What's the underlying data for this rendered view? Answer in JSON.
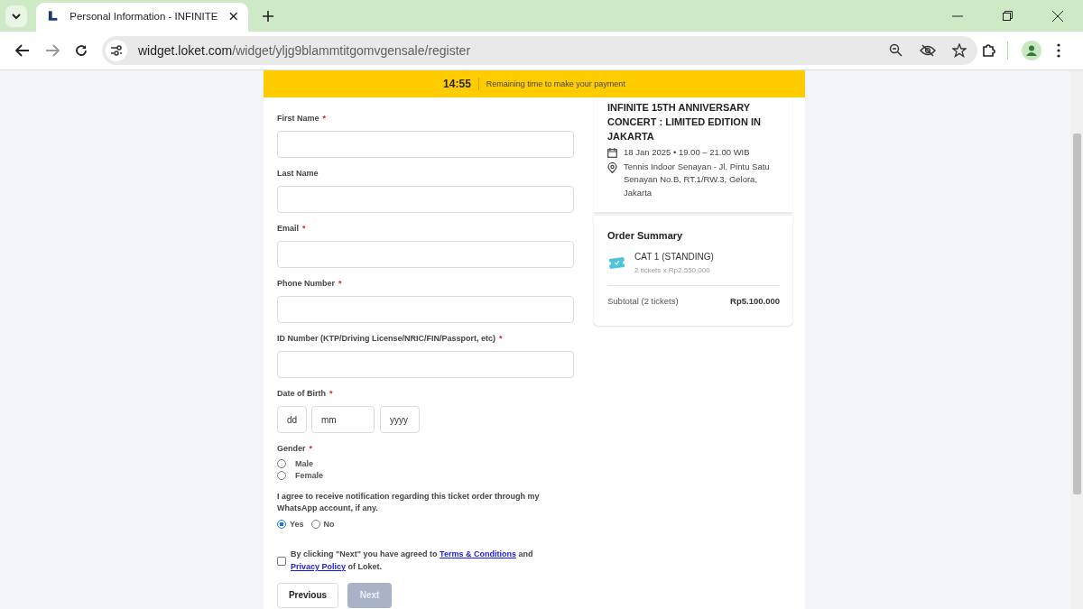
{
  "browser": {
    "tab_title": "Personal Information - INFINITE",
    "url_host": "widget.loket.com",
    "url_path": "/widget/yljg9blammtitgomvgensale/register"
  },
  "timer": {
    "time": "14:55",
    "text": "Remaining time to make your payment"
  },
  "form": {
    "fields": [
      {
        "label": "First Name",
        "required_mark": "*",
        "kind": "text"
      },
      {
        "label": "Last Name",
        "kind": "text"
      },
      {
        "label": "Email",
        "required_mark": "*",
        "kind": "text"
      },
      {
        "label": "Phone Number",
        "required_mark": "*",
        "kind": "text"
      },
      {
        "label": "ID Number (KTP/Driving License/NRIC/FIN/Passport, etc)",
        "required_mark": "*",
        "kind": "text"
      },
      {
        "label": "Date of Birth",
        "required_mark": "*",
        "kind": "date",
        "placeholders": [
          "dd",
          "mm",
          "yyyy"
        ]
      },
      {
        "label": "Gender",
        "required_mark": "*",
        "kind": "radio",
        "options": [
          {
            "label": "Male",
            "selected": false
          },
          {
            "label": "Female",
            "selected": false
          }
        ]
      }
    ],
    "whatsapp": {
      "question": "I agree to receive notification regarding this ticket order through my WhatsApp account, if any.",
      "options": [
        {
          "label": "Yes",
          "selected": true
        },
        {
          "label": "No",
          "selected": false
        }
      ]
    },
    "terms": {
      "checked": false,
      "before": "By clicking \"Next\" you have agreed to",
      "link1": "Terms & Conditions",
      "middle": "and",
      "link2": "Privacy Policy",
      "after": "of Loket."
    },
    "buttons": [
      {
        "label": "Previous",
        "disabled": false
      },
      {
        "label": "Next",
        "disabled": true
      }
    ]
  },
  "event": {
    "title": "INFINITE 15TH ANNIVERSARY CONCERT : LIMITED EDITION IN JAKARTA",
    "date": "18 Jan 2025 • 19.00 – 21.00 WIB",
    "venue": "Tennis Indoor Senayan - Jl. Pintu Satu Senayan No.B, RT.1/RW.3, Gelora, Jakarta"
  },
  "order": {
    "title": "Order Summary",
    "items": [
      {
        "name": "CAT 1 (STANDING)",
        "detail": "2 tickets x Rp2.550.000"
      }
    ],
    "subtotal_label": "Subtotal (2 tickets)",
    "subtotal": "Rp5.100.000"
  }
}
